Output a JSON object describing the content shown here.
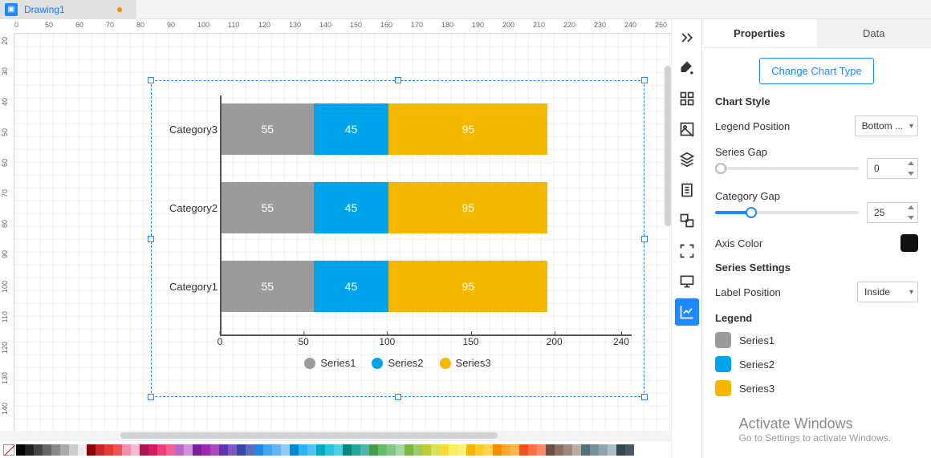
{
  "tab": {
    "title": "Drawing1"
  },
  "ruler_h": [
    "0",
    "50",
    "60",
    "70",
    "80",
    "90",
    "100",
    "110",
    "120",
    "130",
    "140",
    "150",
    "160",
    "170",
    "180",
    "190",
    "200",
    "210",
    "220",
    "230",
    "240",
    "250"
  ],
  "ruler_v": [
    "20",
    "30",
    "40",
    "50",
    "60",
    "70",
    "80",
    "90",
    "100",
    "110",
    "120",
    "130",
    "140"
  ],
  "chart_data": {
    "type": "bar",
    "orientation": "horizontal-stacked",
    "categories": [
      "Category3",
      "Category2",
      "Category1"
    ],
    "series": [
      {
        "name": "Series1",
        "values": [
          55,
          55,
          55
        ],
        "color": "#9b9b9b"
      },
      {
        "name": "Series2",
        "values": [
          45,
          45,
          45
        ],
        "color": "#00a4ea"
      },
      {
        "name": "Series3",
        "values": [
          95,
          95,
          95
        ],
        "color": "#f6b700"
      }
    ],
    "xticks": [
      0,
      50,
      100,
      150,
      200,
      240
    ],
    "xlabel": "",
    "ylabel": "",
    "legend_position": "bottom"
  },
  "panel": {
    "tabs": {
      "props": "Properties",
      "data": "Data"
    },
    "change_btn": "Change Chart Type",
    "chart_style": "Chart Style",
    "legend_pos_label": "Legend Position",
    "legend_pos_value": "Bottom ...",
    "series_gap_label": "Series Gap",
    "series_gap_value": "0",
    "category_gap_label": "Category Gap",
    "category_gap_value": "25",
    "axis_color_label": "Axis Color",
    "axis_color_value": "#111111",
    "series_settings": "Series Settings",
    "label_pos_label": "Label Position",
    "label_pos_value": "Inside",
    "legend_title": "Legend",
    "legend_items": [
      {
        "name": "Series1",
        "color": "#9b9b9b"
      },
      {
        "name": "Series2",
        "color": "#00a4ea"
      },
      {
        "name": "Series3",
        "color": "#f6b700"
      }
    ]
  },
  "watermark": {
    "line1": "Activate Windows",
    "line2": "Go to Settings to activate Windows."
  },
  "palette_colors": [
    "#000",
    "#222",
    "#444",
    "#666",
    "#888",
    "#aaa",
    "#ccc",
    "#eee",
    "#8e0000",
    "#c62828",
    "#e53935",
    "#ef5350",
    "#f48fb1",
    "#f8bbd0",
    "#ad1457",
    "#d81b60",
    "#ec407a",
    "#f06292",
    "#ba68c8",
    "#ce93d8",
    "#7b1fa2",
    "#9c27b0",
    "#ab47bc",
    "#5e35b1",
    "#7e57c2",
    "#3949ab",
    "#5c6bc0",
    "#1e88e5",
    "#42a5f5",
    "#64b5f6",
    "#90caf9",
    "#0288d1",
    "#29b6f6",
    "#4fc3f7",
    "#00acc1",
    "#26c6da",
    "#4dd0e1",
    "#00897b",
    "#26a69a",
    "#4db6ac",
    "#43a047",
    "#66bb6a",
    "#81c784",
    "#a5d6a7",
    "#7cb342",
    "#9ccc65",
    "#c0ca33",
    "#d4e157",
    "#fdd835",
    "#ffee58",
    "#fff176",
    "#ffb300",
    "#ffca28",
    "#ffd54f",
    "#fb8c00",
    "#ffa726",
    "#ffb74d",
    "#f4511e",
    "#ff7043",
    "#ff8a65",
    "#6d4c41",
    "#8d6e63",
    "#a1887f",
    "#bcaaa4",
    "#546e7a",
    "#78909c",
    "#90a4ae",
    "#b0bec5",
    "#37474f",
    "#455a64"
  ]
}
